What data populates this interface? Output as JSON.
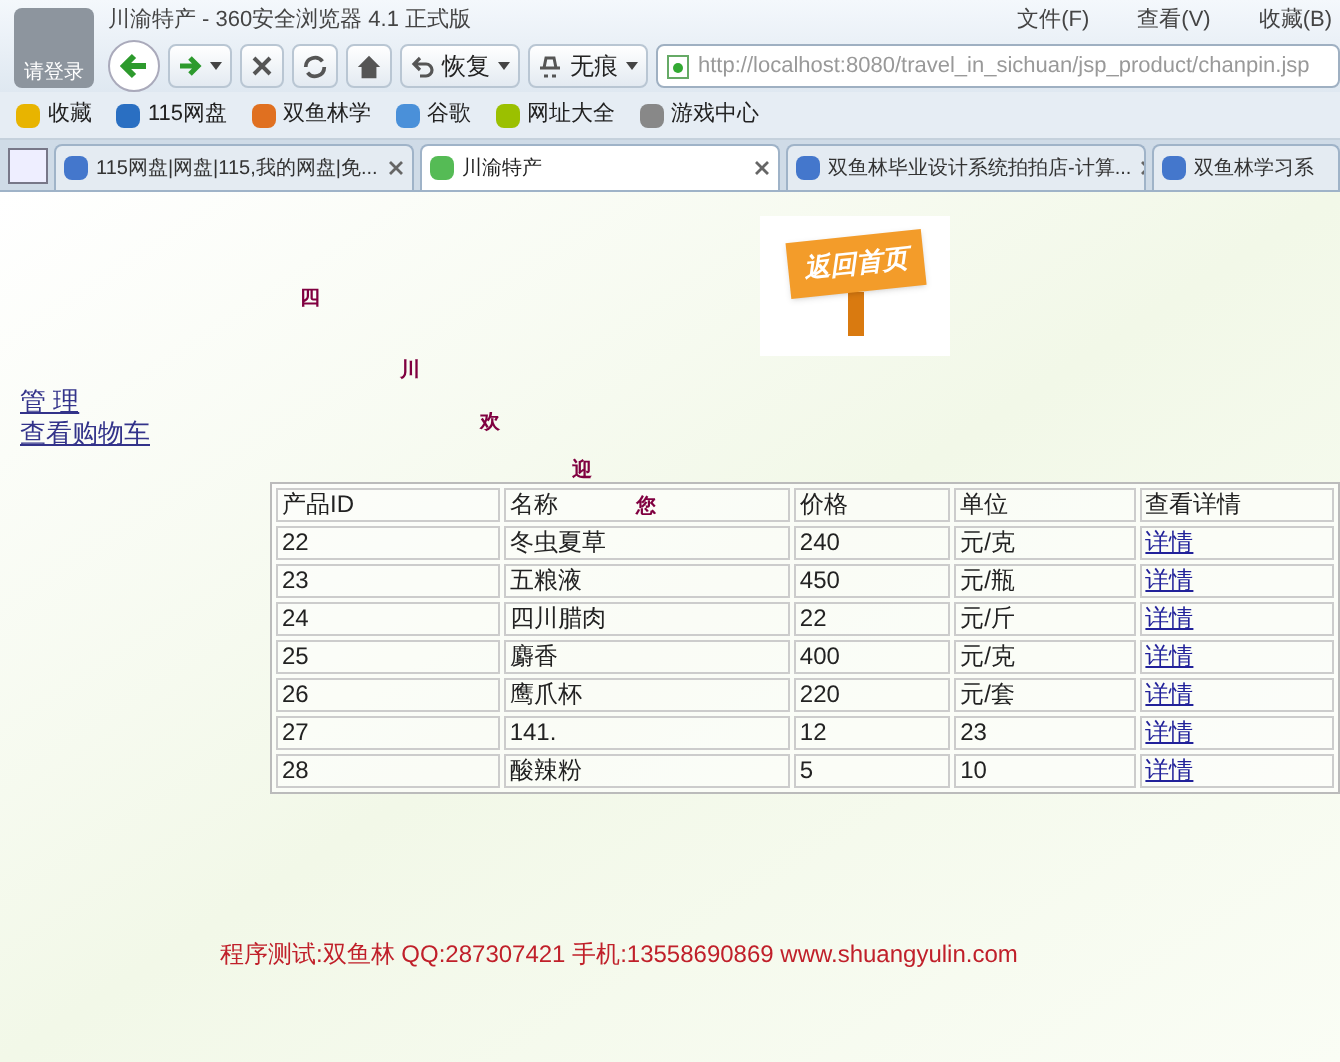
{
  "window": {
    "title": "川渝特产 - 360安全浏览器 4.1 正式版",
    "login_label": "请登录",
    "menu": [
      "文件(F)",
      "查看(V)",
      "收藏(B)"
    ]
  },
  "toolbar": {
    "restore": "恢复",
    "incognito": "无痕",
    "url": "http://localhost:8080/travel_in_sichuan/jsp_product/chanpin.jsp"
  },
  "bookmarks": [
    "收藏",
    "115网盘",
    "双鱼林学",
    "谷歌",
    "网址大全",
    "游戏中心"
  ],
  "tabs": [
    {
      "label": "115网盘|网盘|115,我的网盘|免...",
      "selected": false
    },
    {
      "label": "川渝特产",
      "selected": true
    },
    {
      "label": "双鱼林毕业设计系统拍拍店-计算...",
      "selected": false
    },
    {
      "label": "双鱼林学习系",
      "selected": false
    }
  ],
  "page": {
    "home_sign": "返回首页",
    "links": [
      "管 理",
      "查看购物车"
    ],
    "welcome": [
      "四",
      "川",
      "欢",
      "迎",
      "您"
    ],
    "table": {
      "columns": [
        "产品ID",
        "名称",
        "价格",
        "单位",
        "查看详情"
      ],
      "rows": [
        [
          "22",
          "冬虫夏草",
          "240",
          "元/克",
          "详情"
        ],
        [
          "23",
          "五粮液",
          "450",
          "元/瓶",
          "详情"
        ],
        [
          "24",
          "四川腊肉",
          "22",
          "元/斤",
          "详情"
        ],
        [
          "25",
          "麝香",
          "400",
          "元/克",
          "详情"
        ],
        [
          "26",
          "鹰爪杯",
          "220",
          "元/套",
          "详情"
        ],
        [
          "27",
          "141.",
          "12",
          "23",
          "详情"
        ],
        [
          "28",
          "酸辣粉",
          "5",
          "10",
          "详情"
        ]
      ]
    },
    "footer": "程序测试:双鱼林 QQ:287307421 手机:13558690869 www.shuangyulin.com"
  }
}
